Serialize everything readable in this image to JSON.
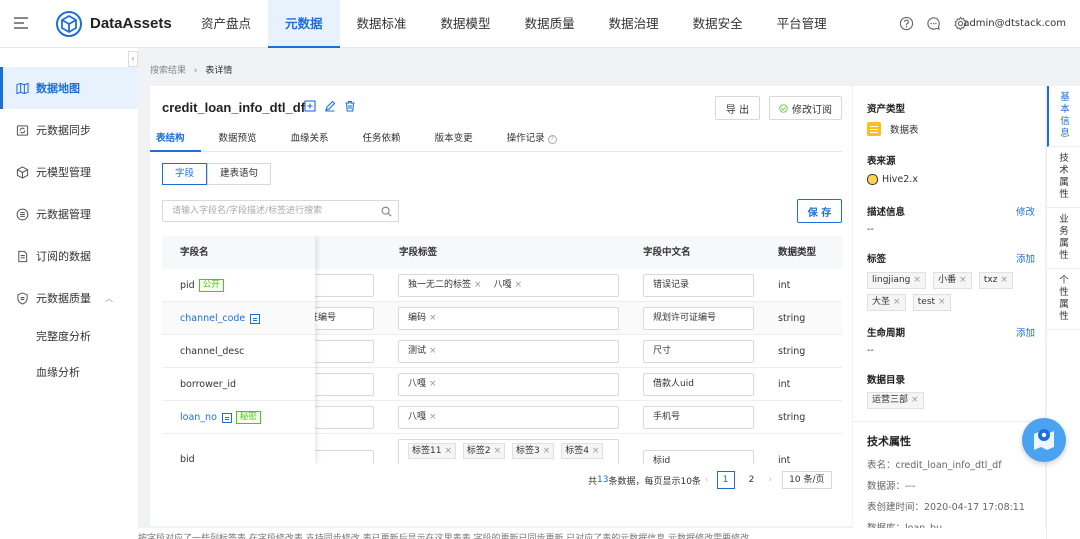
{
  "app": {
    "brand": "DataAssets",
    "user": "admin@dtstack.com"
  },
  "nav": [
    "资产盘点",
    "元数据",
    "数据标准",
    "数据模型",
    "数据质量",
    "数据治理",
    "数据安全",
    "平台管理"
  ],
  "sidebar": {
    "items": [
      "数据地图",
      "元数据同步",
      "元模型管理",
      "元数据管理",
      "订阅的数据",
      "元数据质量"
    ],
    "subitems": [
      "完整度分析",
      "血缘分析"
    ],
    "collapse": "‹"
  },
  "breadcrumb": {
    "parent": "搜索结果",
    "sep": "›",
    "current": "表详情"
  },
  "table": {
    "title": "credit_loan_info_dtl_df",
    "export_label": "导 出",
    "subscribe_label": "修改订阅",
    "tabs": [
      "表结构",
      "数据预览",
      "血缘关系",
      "任务依赖",
      "版本变更",
      "操作记录"
    ],
    "seg": [
      "字段",
      "建表语句"
    ],
    "search_placeholder": "请输入字段名/字段描述/标签进行搜索",
    "save_label": "保 存",
    "columns": {
      "name": "字段名",
      "tags": "字段标签",
      "cn": "字段中文名",
      "type": "数据类型"
    },
    "rows": [
      {
        "name": "pid",
        "badge": "公开",
        "desc": "",
        "tags": [
          "独一无二的标签",
          "八嘎"
        ],
        "cn": "错误记录",
        "type": "int"
      },
      {
        "name": "channel_code",
        "badge": "",
        "desc": "证编号",
        "tags": [
          "编码"
        ],
        "cn": "规划许可证编号",
        "type": "string"
      },
      {
        "name": "channel_desc",
        "badge": "",
        "desc": "",
        "tags": [
          "测试"
        ],
        "cn": "尺寸",
        "type": "string"
      },
      {
        "name": "borrower_id",
        "badge": "",
        "desc": "",
        "tags": [
          "八嘎"
        ],
        "cn": "借款人uid",
        "type": "int"
      },
      {
        "name": "loan_no",
        "badge": "秘密",
        "desc": "",
        "tags": [
          "八嘎"
        ],
        "cn": "手机号",
        "type": "string"
      },
      {
        "name": "bid",
        "badge": "",
        "desc": "",
        "tags": [
          "标签11",
          "标签2",
          "标签3",
          "标签4"
        ],
        "cn": "标id",
        "type": "int"
      }
    ],
    "remove_glyph": "×",
    "pager": {
      "summary_pre": "共",
      "total": "13",
      "summary_post": "条数据，每页显示10条",
      "prev": "‹",
      "next": "›",
      "pages": [
        "1",
        "2"
      ],
      "size": "10 条/页"
    }
  },
  "info": {
    "asset_type_label": "资产类型",
    "asset_type": "数据表",
    "source_label": "表来源",
    "source": "Hive2.x",
    "desc_label": "描述信息",
    "desc_action": "修改",
    "desc_value": "--",
    "tags_label": "标签",
    "tags_action": "添加",
    "tags": [
      "lingjiang",
      "小番",
      "txz",
      "大圣",
      "test"
    ],
    "lifecycle_label": "生命周期",
    "lifecycle_action": "添加",
    "lifecycle_value": "--",
    "catalog_label": "数据目录",
    "catalog": "运营三部",
    "tech_label": "技术属性",
    "tech_name": "表名：credit_loan_info_dtl_df",
    "tech_source": "数据源：---",
    "tech_created": "表创建时间：2020-04-17 17:08:11",
    "tech_db": "数据库：loan_bu"
  },
  "right_tabs": [
    "基本信息",
    "技术属性",
    "业务属性",
    "个性属性"
  ],
  "bottom_text": "按字段对应了一些列标签表  在字段修改表  支持同步修改 表已更新后显示在这里表表 字段的更新已同步更新  已对应了表的元数据信息  元数据修改需要修改"
}
